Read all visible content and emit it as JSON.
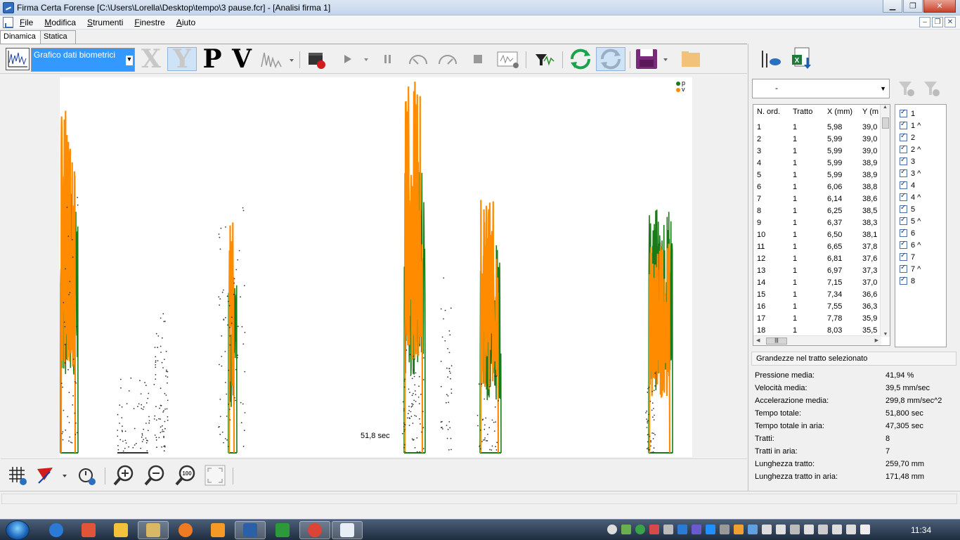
{
  "window": {
    "title": "Firma Certa Forense [C:\\Users\\Lorella\\Desktop\\tempo\\3 pause.fcr] - [Analisi firma 1]"
  },
  "menu": {
    "items": [
      {
        "first": "F",
        "rest": "ile"
      },
      {
        "first": "M",
        "rest": "odifica"
      },
      {
        "first": "S",
        "rest": "trumenti"
      },
      {
        "first": "F",
        "rest": "inestre"
      },
      {
        "first": "A",
        "rest": "iuto"
      }
    ]
  },
  "tabs": [
    {
      "label": "Dinamica",
      "active": true
    },
    {
      "label": "Statica",
      "active": false
    }
  ],
  "toolbar": {
    "graph_combo_value": "Grafico dati biometrici",
    "letters": [
      {
        "label": "X",
        "state": "disabled"
      },
      {
        "label": "Y",
        "state": "selected"
      },
      {
        "label": "P",
        "state": "enabled"
      },
      {
        "label": "V",
        "state": "enabled"
      }
    ]
  },
  "chart": {
    "legend": [
      {
        "label": "p",
        "color": "#1a7a1a"
      },
      {
        "label": "v",
        "color": "#ff8c00"
      }
    ],
    "time_label": "51,8 sec",
    "colors": {
      "pressure": "#1a7a1a",
      "velocity": "#ff8c00",
      "air": "#333333"
    }
  },
  "chart_data": {
    "type": "line",
    "series": [
      {
        "name": "p"
      },
      {
        "name": "v"
      }
    ]
  },
  "right_panel": {
    "filter_value": "-",
    "table": {
      "columns": [
        "N. ord.",
        "Tratto",
        "X (mm)",
        "Y (m"
      ],
      "rows": [
        [
          "1",
          "1",
          "5,98",
          "39,0"
        ],
        [
          "2",
          "1",
          "5,99",
          "39,0"
        ],
        [
          "3",
          "1",
          "5,99",
          "39,0"
        ],
        [
          "4",
          "1",
          "5,99",
          "38,9"
        ],
        [
          "5",
          "1",
          "5,99",
          "38,9"
        ],
        [
          "6",
          "1",
          "6,06",
          "38,8"
        ],
        [
          "7",
          "1",
          "6,14",
          "38,6"
        ],
        [
          "8",
          "1",
          "6,25",
          "38,5"
        ],
        [
          "9",
          "1",
          "6,37",
          "38,3"
        ],
        [
          "10",
          "1",
          "6,50",
          "38,1"
        ],
        [
          "11",
          "1",
          "6,65",
          "37,8"
        ],
        [
          "12",
          "1",
          "6,81",
          "37,6"
        ],
        [
          "13",
          "1",
          "6,97",
          "37,3"
        ],
        [
          "14",
          "1",
          "7,15",
          "37,0"
        ],
        [
          "15",
          "1",
          "7,34",
          "36,6"
        ],
        [
          "16",
          "1",
          "7,55",
          "36,3"
        ],
        [
          "17",
          "1",
          "7,78",
          "35,9"
        ],
        [
          "18",
          "1",
          "8,03",
          "35,5"
        ]
      ]
    },
    "strokes": [
      "1",
      "1 ^",
      "2",
      "2 ^",
      "3",
      "3 ^",
      "4",
      "4 ^",
      "5",
      "5 ^",
      "6",
      "6 ^",
      "7",
      "7 ^",
      "8"
    ],
    "section_title": "Grandezze nel tratto selezionato",
    "stats": [
      {
        "label": "Pressione media:",
        "value": "41,94 %"
      },
      {
        "label": "Velocità media:",
        "value": "39,5 mm/sec"
      },
      {
        "label": "Accelerazione media:",
        "value": "299,8 mm/sec^2"
      },
      {
        "label": "Tempo totale:",
        "value": "51,800 sec"
      },
      {
        "label": "Tempo totale in aria:",
        "value": "47,305 sec"
      },
      {
        "label": "Tratti:",
        "value": "8"
      },
      {
        "label": "Tratti in aria:",
        "value": "7"
      },
      {
        "label": "Lunghezza tratto:",
        "value": "259,70 mm"
      },
      {
        "label": "Lunghezza tratto in aria:",
        "value": "171,48 mm"
      }
    ]
  },
  "taskbar": {
    "clock": "11:34"
  }
}
